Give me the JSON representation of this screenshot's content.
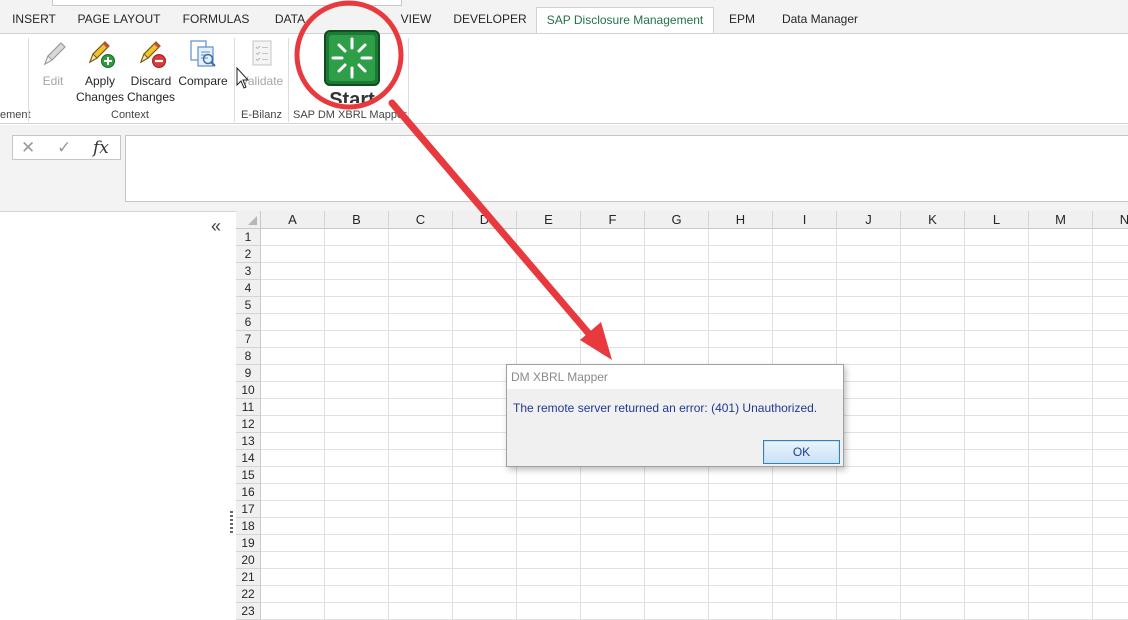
{
  "ribbon_tabs": [
    "INSERT",
    "PAGE LAYOUT",
    "FORMULAS",
    "DATA",
    "VIEW",
    "DEVELOPER",
    "SAP Disclosure Management",
    "EPM",
    "Data Manager"
  ],
  "active_tab": "SAP Disclosure Management",
  "ribbon": {
    "truncated_group_label": "ement",
    "context_group": {
      "label": "Context",
      "edit": "Edit",
      "apply": [
        "Apply",
        "Changes"
      ],
      "discard": [
        "Discard",
        "Changes"
      ],
      "compare": "Compare"
    },
    "ebilanz_group": {
      "label": "E-Bilanz",
      "validate": "Validate"
    },
    "xbrl_group": {
      "label": "SAP DM XBRL Mapper",
      "start": "Start"
    }
  },
  "formula_bar": {
    "fx_symbol": "fx",
    "value": ""
  },
  "sheet": {
    "columns": [
      "A",
      "B",
      "C",
      "D",
      "E",
      "F",
      "G",
      "H",
      "I",
      "J",
      "K",
      "L",
      "M",
      "N"
    ],
    "rows": [
      "1",
      "2",
      "3",
      "4",
      "5",
      "6",
      "7",
      "8",
      "9",
      "10",
      "11",
      "12",
      "13",
      "14",
      "15",
      "16",
      "17",
      "18",
      "19",
      "20",
      "21",
      "22",
      "23"
    ]
  },
  "task_pane": {
    "collapse_glyph": "«"
  },
  "dialog": {
    "title": "DM XBRL Mapper",
    "message": "The remote server returned an error: (401) Unauthorized.",
    "ok_label": "OK"
  },
  "colors": {
    "excel_green": "#217346",
    "annotation_red": "#e8393f",
    "dialog_text": "#1f3a93",
    "start_icon_green": "#1e8a3a"
  }
}
